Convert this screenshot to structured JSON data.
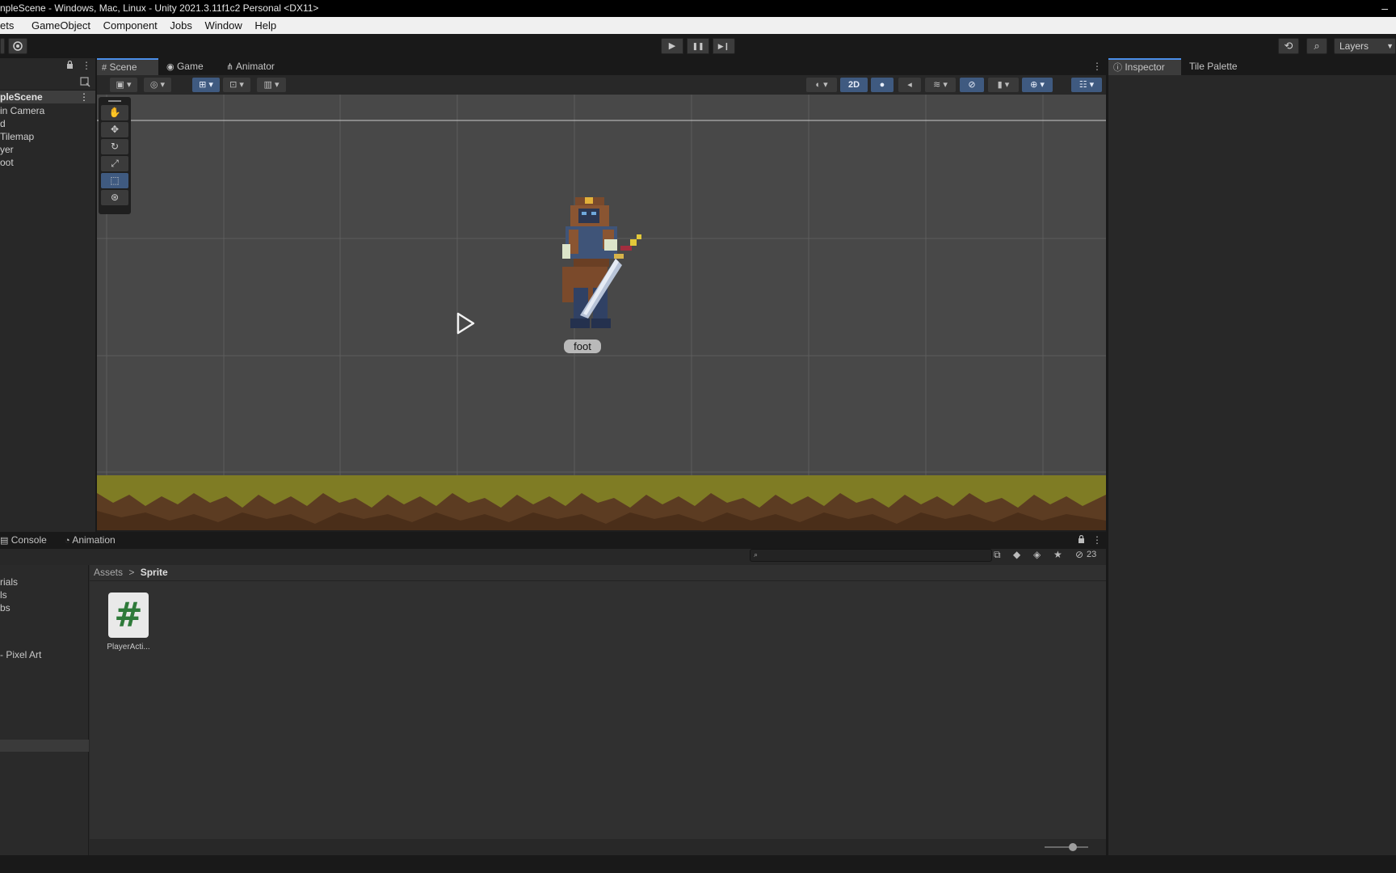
{
  "window": {
    "title": "npleScene - Windows, Mac, Linux - Unity 2021.3.11f1c2 Personal <DX11>",
    "minimize": "–"
  },
  "menu": [
    "ets",
    "GameObject",
    "Component",
    "Jobs",
    "Window",
    "Help"
  ],
  "toolbar": {
    "play": "▶",
    "pause": "❚❚",
    "step": "▶❙",
    "history": "⟲",
    "search": "⌕",
    "layers_label": "Layers"
  },
  "hierarchy": {
    "scene": "pleScene",
    "items": [
      "in Camera",
      "d",
      "Tilemap",
      "yer",
      "oot"
    ]
  },
  "scene_tabs": [
    "Scene",
    "Game",
    "Animator"
  ],
  "scene_toolbar": {
    "mode_2d": "2D"
  },
  "scene_view": {
    "selected_label": "foot"
  },
  "right_tabs": [
    "Inspector",
    "Tile Palette"
  ],
  "bottom_tabs": [
    "Console",
    "Animation"
  ],
  "project": {
    "folders": [
      "rials",
      "ls",
      "bs",
      "- Pixel Art"
    ],
    "breadcrumb": [
      "Assets",
      "Sprite"
    ],
    "breadcrumb_sep": ">",
    "asset": {
      "name": "PlayerActi...",
      "glyph": "#"
    },
    "hidden_count": "23"
  }
}
